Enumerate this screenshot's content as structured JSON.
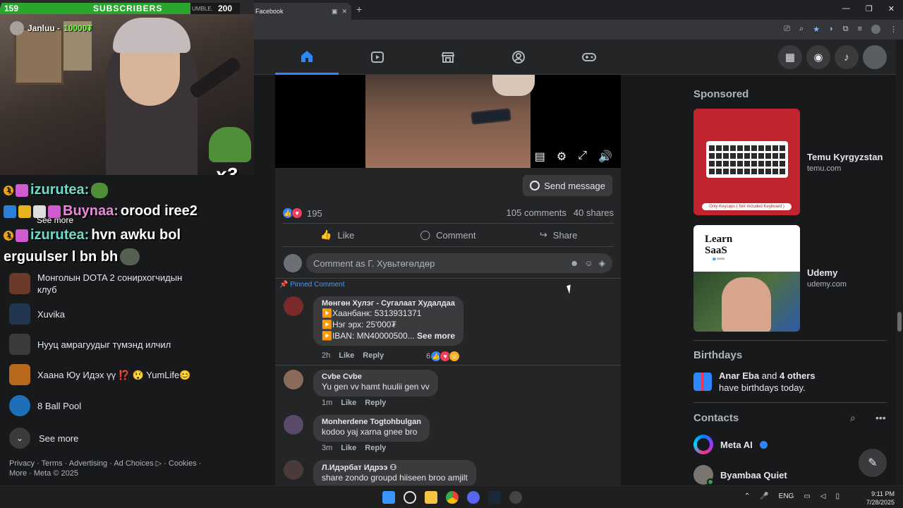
{
  "browser": {
    "tab_title": "Facebook",
    "tab_favicon": "f",
    "new_tab": "+",
    "win_min": "—",
    "win_max": "❐",
    "win_close": "✕"
  },
  "stream": {
    "subscriber_count": "159",
    "subscriber_label": "SUBSCRIBERS",
    "ticker_text": "UMBLE.",
    "ticker_num": "200",
    "donor_name": "Janluu - ",
    "donor_amount": "10000₮",
    "multiplier": "x3"
  },
  "chat": [
    {
      "badge": "1",
      "name": "izurutea:",
      "message": ""
    },
    {
      "badge": "",
      "name": "Buynaa:",
      "message": " orood iree2"
    },
    {
      "badge": "1",
      "name": "izurutea:",
      "message": " hvn awku bol"
    },
    {
      "badge": "",
      "name": "",
      "message": "erguulser l bn bh"
    }
  ],
  "chat_see_more": "See more",
  "left_sidebar": {
    "items": [
      {
        "label": "Монголын DOTA 2 сонирхогчидын клуб",
        "color": "#6b3a2a"
      },
      {
        "label": "Xuvika",
        "color": "#23364f"
      },
      {
        "label": "Нууц амрагуудыг түмэнд илчил",
        "color": "#3b3b3b"
      },
      {
        "label": "Хаана Юу Идэх үү ⁉️ 😲 YumLife😊",
        "color": "#b86a1c"
      },
      {
        "label": "8 Ball Pool",
        "color": "#1c6fb8"
      }
    ],
    "see_more": "See more",
    "footer": "Privacy · Terms · Advertising · Ad Choices ▷ · Cookies · More · Meta © 2025"
  },
  "post": {
    "send_message": "Send message",
    "reaction_count": "195",
    "comments": "105 comments",
    "shares": "40 shares",
    "like": "Like",
    "comment": "Comment",
    "share": "Share",
    "comment_placeholder": "Comment as Г. Хувьтөгөлдөр",
    "pinned_label": "📌 Pinned Comment"
  },
  "comments": [
    {
      "author": "Мөнгөн Хулэг - Сугалаат Худалдаа",
      "lines": [
        "▶️Хаанбанк: 5313931371",
        "▶️Нэг эрх: 25'000₮",
        "▶️IBAN: MN40000500..."
      ],
      "see_more": "See more",
      "time": "2h",
      "like": "Like",
      "reply": "Reply",
      "reactions": "6",
      "avatar_color": "#7a2a2a"
    },
    {
      "author": "Cvbe Cvbe",
      "text": "Yu gen vv hamt huulii gen vv",
      "time": "1m",
      "like": "Like",
      "reply": "Reply",
      "avatar_color": "#8a6a5a"
    },
    {
      "author": "Monherdene Togtohbulgan",
      "text": "kodoo yaj xarna gnee bro",
      "time": "3m",
      "like": "Like",
      "reply": "Reply",
      "avatar_color": "#5a4a6a"
    },
    {
      "author": "Л.Идэрбат Идрээ",
      "text": "share zondo groupd hiiseen broo amjilt",
      "avatar_color": "#4a3a3a"
    }
  ],
  "right": {
    "sponsored": "Sponsored",
    "ads": [
      {
        "name": "Temu Kyrgyzstan",
        "url": "temu.com",
        "banner": "Only Keycaps ( Not included Keyboard )"
      },
      {
        "name": "Udemy",
        "url": "udemy.com",
        "banner_line1": "Learn",
        "banner_line2": "SaaS",
        "banner_small": "👥 35950"
      }
    ],
    "birthdays_title": "Birthdays",
    "birthday_name": "Anar Eba",
    "birthday_mid": " and ",
    "birthday_others": "4 others",
    "birthday_end": " have birthdays today.",
    "contacts_title": "Contacts",
    "contacts": [
      {
        "name": "Meta AI",
        "verified": true
      },
      {
        "name": "Byambaa Quiet",
        "online": true
      }
    ]
  },
  "taskbar": {
    "lang": "ENG",
    "time": "9:11 PM",
    "date": "7/28/2025"
  },
  "colors": {
    "accent": "#2d88ff",
    "background": "#18191a",
    "card": "#242526",
    "temu_red": "#c0242e"
  }
}
